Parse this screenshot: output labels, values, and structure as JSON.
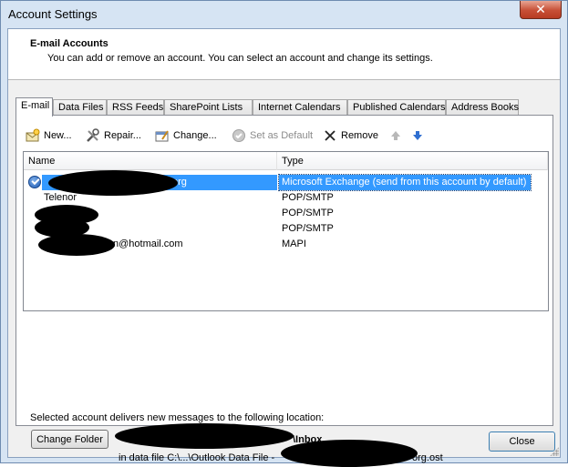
{
  "window": {
    "title": "Account Settings",
    "close_glyph": "✕"
  },
  "header": {
    "title": "E-mail Accounts",
    "description": "You can add or remove an account. You can select an account and change its settings."
  },
  "tabs": [
    {
      "label": "E-mail",
      "active": true
    },
    {
      "label": "Data Files",
      "active": false
    },
    {
      "label": "RSS Feeds",
      "active": false
    },
    {
      "label": "SharePoint Lists",
      "active": false
    },
    {
      "label": "Internet Calendars",
      "active": false
    },
    {
      "label": "Published Calendars",
      "active": false
    },
    {
      "label": "Address Books",
      "active": false
    }
  ],
  "toolbar": {
    "new_label": "New...",
    "repair_label": "Repair...",
    "change_label": "Change...",
    "set_default_label": "Set as Default",
    "remove_label": "Remove",
    "move_up_icon": "arrow-up-icon",
    "move_down_icon": "arrow-down-icon"
  },
  "accounts_table": {
    "columns": [
      "Name",
      "Type"
    ],
    "rows": [
      {
        "name": "org",
        "type": "Microsoft Exchange (send from this account by default)",
        "selected": true,
        "default": true
      },
      {
        "name": "Telenor",
        "type": "POP/SMTP",
        "selected": false
      },
      {
        "name": "",
        "type": "POP/SMTP",
        "selected": false
      },
      {
        "name": "",
        "type": "POP/SMTP",
        "selected": false
      },
      {
        "name": "n@hotmail.com",
        "type": "MAPI",
        "selected": false
      }
    ]
  },
  "delivery": {
    "label": "Selected account delivers new messages to the following location:",
    "change_folder_label": "Change Folder",
    "inbox_label": "\\Inbox",
    "datafile_prefix": "in data file C:\\...\\Outlook Data File -",
    "datafile_suffix": "org.ost"
  },
  "footer": {
    "close_label": "Close"
  },
  "colors": {
    "selection": "#3399ff",
    "frame": "#d6e4f3",
    "close_button_red": "#c74f36"
  }
}
